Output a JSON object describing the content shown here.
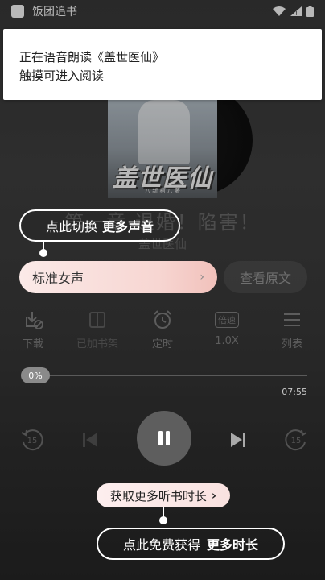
{
  "status_bar": {
    "app_name": "饭团追书"
  },
  "notification": {
    "line1": "正在语音朗读《盖世医仙》",
    "line2": "触摸可进入阅读"
  },
  "cover": {
    "title": "盖世医仙",
    "author": "八 新 柯 八 著"
  },
  "chapter": {
    "title": "第一章 退婚！陷害！",
    "book_name": "盖世医仙"
  },
  "switch_tip": {
    "prefix": "点此切换",
    "bold": "更多声音"
  },
  "voice": {
    "selected": "标准女声",
    "chevron": "›"
  },
  "view_original_label": "查看原文",
  "tools": {
    "download": "下载",
    "shelf": "已加书架",
    "timer": "定时",
    "speed_badge": "倍速",
    "speed": "1.0X",
    "list": "列表"
  },
  "progress": {
    "percent_label": "0%",
    "total_time": "07:55",
    "fraction": 0
  },
  "controls": {
    "rewind_seconds": "15",
    "forward_seconds": "15"
  },
  "earn_button": {
    "label": "获取更多听书时长",
    "arrow": "›"
  },
  "free_tip": {
    "prefix": "点此免费获得",
    "bold": "更多时长"
  }
}
